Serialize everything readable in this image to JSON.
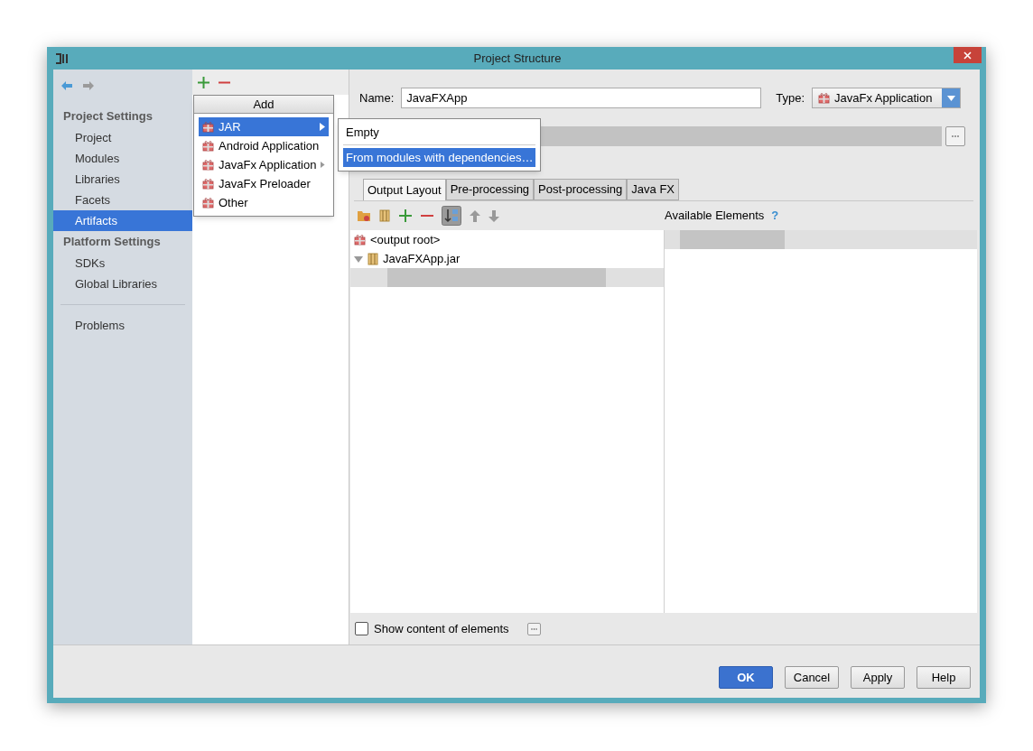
{
  "window": {
    "title": "Project Structure"
  },
  "sidebar": {
    "sections": [
      {
        "heading": "Project Settings",
        "items": [
          {
            "label": "Project",
            "selected": false
          },
          {
            "label": "Modules",
            "selected": false
          },
          {
            "label": "Libraries",
            "selected": false
          },
          {
            "label": "Facets",
            "selected": false
          },
          {
            "label": "Artifacts",
            "selected": true
          }
        ]
      },
      {
        "heading": "Platform Settings",
        "items": [
          {
            "label": "SDKs",
            "selected": false
          },
          {
            "label": "Global Libraries",
            "selected": false
          }
        ]
      },
      {
        "items": [
          {
            "label": "Problems",
            "selected": false
          }
        ]
      }
    ]
  },
  "add_menu": {
    "title": "Add",
    "items": [
      {
        "label": "JAR",
        "has_submenu": true,
        "selected": true
      },
      {
        "label": "Android Application",
        "has_submenu": false,
        "selected": false
      },
      {
        "label": "JavaFx Application",
        "has_submenu": true,
        "selected": false
      },
      {
        "label": "JavaFx Preloader",
        "has_submenu": false,
        "selected": false
      },
      {
        "label": "Other",
        "has_submenu": false,
        "selected": false
      }
    ]
  },
  "submenu": {
    "items": [
      {
        "label": "Empty",
        "selected": false
      },
      {
        "label": "From modules with dependencies…",
        "selected": true
      }
    ]
  },
  "name_field": {
    "label": "Name:",
    "value": "JavaFXApp"
  },
  "type_field": {
    "label": "Type:",
    "value": "JavaFx Application"
  },
  "tabs": [
    {
      "label": "Output Layout",
      "selected": true
    },
    {
      "label": "Pre-processing",
      "selected": false
    },
    {
      "label": "Post-processing",
      "selected": false
    },
    {
      "label": "Java FX",
      "selected": false
    }
  ],
  "available_elements": {
    "label": "Available Elements",
    "help": "?"
  },
  "output_tree": [
    {
      "label": "<output root>",
      "kind": "root"
    },
    {
      "label": "JavaFXApp.jar",
      "kind": "jar",
      "expanded": true
    }
  ],
  "show_content": {
    "label": "Show content of elements",
    "checked": false
  },
  "buttons": [
    {
      "label": "OK",
      "kind": "primary"
    },
    {
      "label": "Cancel",
      "kind": "default"
    },
    {
      "label": "Apply",
      "kind": "default"
    },
    {
      "label": "Help",
      "kind": "default"
    }
  ]
}
